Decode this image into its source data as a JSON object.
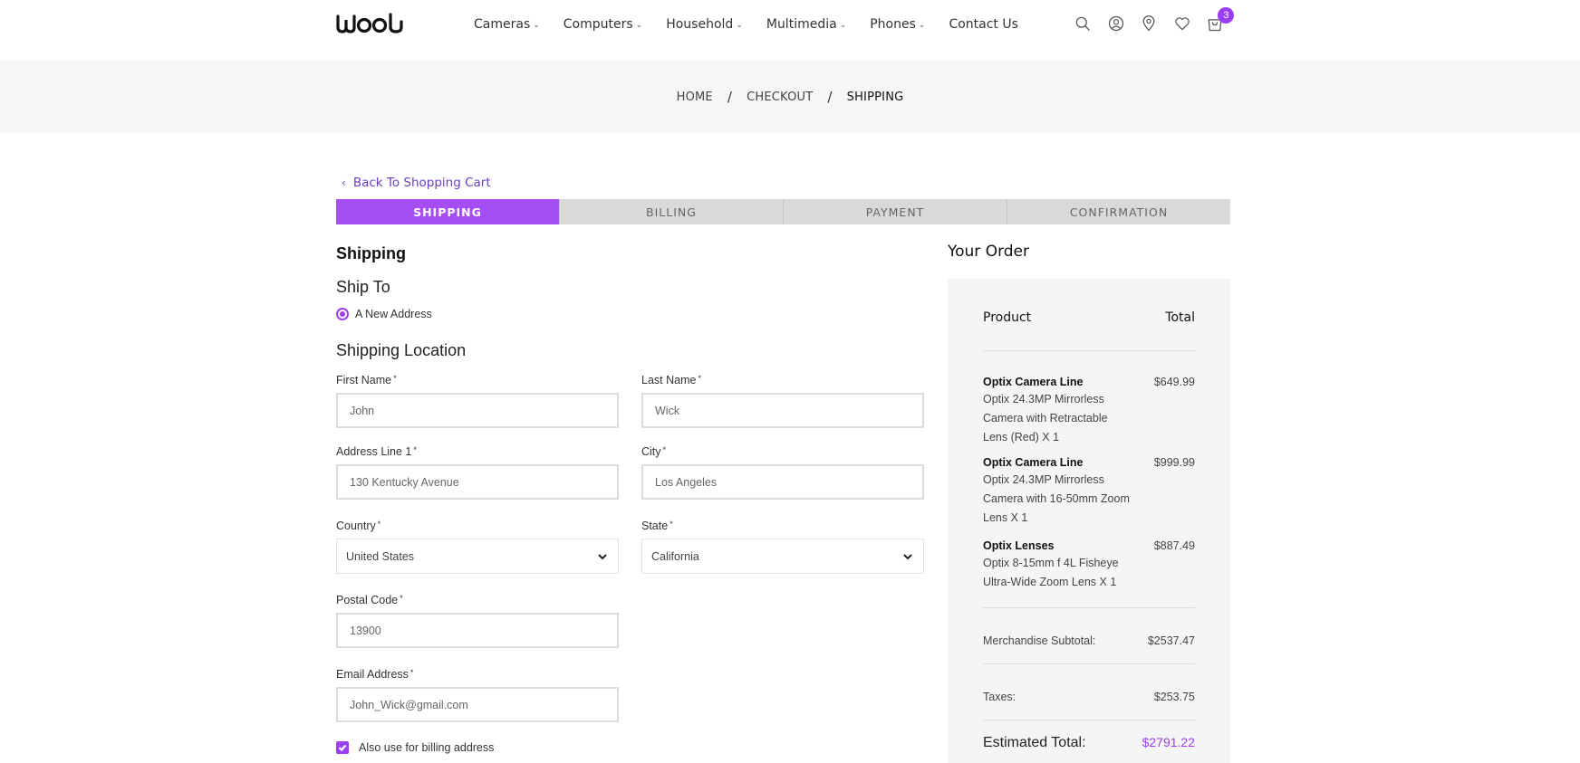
{
  "brand": {
    "logo_text": "WOOL",
    "accent_color": "#a64ef5"
  },
  "nav": {
    "items": [
      "Cameras",
      "Computers",
      "Household",
      "Multimedia",
      "Phones",
      "Contact Us"
    ]
  },
  "header_icons": {
    "search": "search-icon",
    "account": "user-icon",
    "location": "map-pin-icon",
    "wishlist": "heart-icon",
    "cart": "shopping-bag-icon",
    "cart_count": "3"
  },
  "breadcrumb": {
    "home": "HOME",
    "checkout": "CHECKOUT",
    "current": "SHIPPING",
    "separator": "/"
  },
  "back_link": {
    "label": "Back To Shopping Cart"
  },
  "steps": [
    "SHIPPING",
    "BILLING",
    "PAYMENT",
    "CONFIRMATION"
  ],
  "form": {
    "heading": "Shipping",
    "ship_to_heading": "Ship To",
    "address_option": "A New Address",
    "location_heading": "Shipping Location",
    "required_mark": "*",
    "first_name": {
      "label": "First Name",
      "value": "John"
    },
    "last_name": {
      "label": "Last Name",
      "value": "Wick"
    },
    "address1": {
      "label": "Address Line 1",
      "value": "130 Kentucky Avenue"
    },
    "city": {
      "label": "City",
      "value": "Los Angeles"
    },
    "country": {
      "label": "Country",
      "value": "United States"
    },
    "state": {
      "label": "State",
      "value": "California"
    },
    "postal": {
      "label": "Postal Code",
      "value": "13900"
    },
    "email": {
      "label": "Email Address",
      "value": "John_Wick@gmail.com"
    },
    "billing_checkbox": "Also use for billing address"
  },
  "order": {
    "title": "Your Order",
    "col_product": "Product",
    "col_total": "Total",
    "items": [
      {
        "name": "Optix Camera Line",
        "desc": "Optix 24.3MP Mirrorless Camera with Retractable Lens (Red) X 1",
        "price": "$649.99"
      },
      {
        "name": "Optix Camera Line",
        "desc": "Optix 24.3MP Mirrorless Camera with 16-50mm Zoom Lens X 1",
        "price": "$999.99"
      },
      {
        "name": "Optix Lenses",
        "desc": "Optix 8-15mm f 4L Fisheye Ultra-Wide Zoom Lens X 1",
        "price": "$887.49"
      }
    ],
    "subtotal_label": "Merchandise Subtotal:",
    "subtotal_value": "$2537.47",
    "taxes_label": "Taxes:",
    "taxes_value": "$253.75",
    "total_label": "Estimated Total:",
    "total_value": "$2791.22"
  }
}
